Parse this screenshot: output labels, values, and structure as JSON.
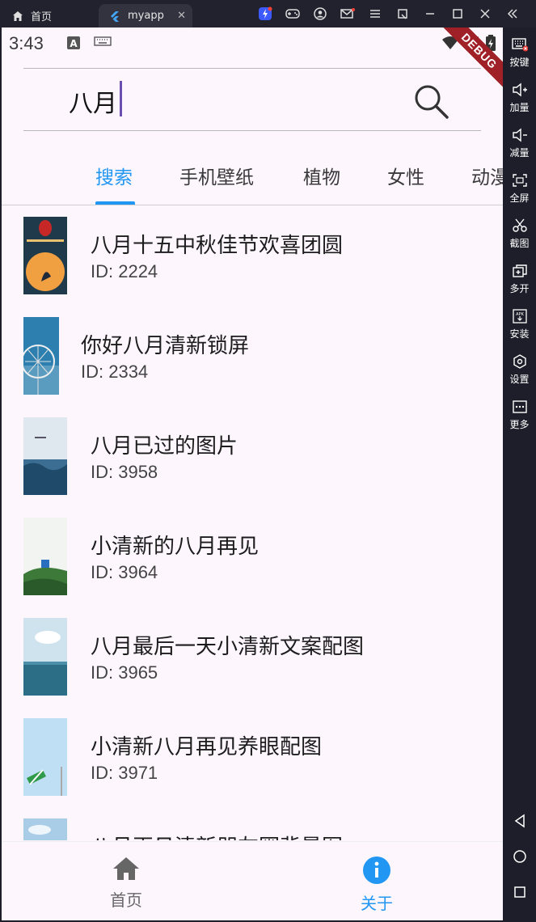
{
  "host": {
    "home_tab": "首页",
    "app_tab": "myapp",
    "sidebar": [
      {
        "label": "按键",
        "icon": "keyboard-icon"
      },
      {
        "label": "加量",
        "icon": "volume-up-icon"
      },
      {
        "label": "减量",
        "icon": "volume-down-icon"
      },
      {
        "label": "全屏",
        "icon": "fullscreen-icon"
      },
      {
        "label": "截图",
        "icon": "scissors-icon"
      },
      {
        "label": "多开",
        "icon": "multi-instance-icon"
      },
      {
        "label": "安装",
        "icon": "apk-install-icon"
      },
      {
        "label": "设置",
        "icon": "settings-icon"
      },
      {
        "label": "更多",
        "icon": "more-icon"
      }
    ]
  },
  "status": {
    "time": "3:43",
    "debug_banner": "DEBUG"
  },
  "search": {
    "value": "八月"
  },
  "tabs": [
    "搜索",
    "手机壁纸",
    "植物",
    "女性",
    "动漫"
  ],
  "results": [
    {
      "title": "八月十五中秋佳节欢喜团圆",
      "id": "ID: 2224"
    },
    {
      "title": "你好八月清新锁屏",
      "id": "ID: 2334"
    },
    {
      "title": "八月已过的图片",
      "id": "ID: 3958"
    },
    {
      "title": "小清新的八月再见",
      "id": "ID: 3964"
    },
    {
      "title": "八月最后一天小清新文案配图",
      "id": "ID: 3965"
    },
    {
      "title": "小清新八月再见养眼配图",
      "id": "ID: 3971"
    },
    {
      "title": "八月再见清新朋友圈背景图",
      "id": ""
    }
  ],
  "bottom_nav": {
    "home": "首页",
    "about": "关于"
  },
  "colors": {
    "accent": "#2196f3",
    "background": "#fdf7fd",
    "debug": "#a02028"
  }
}
